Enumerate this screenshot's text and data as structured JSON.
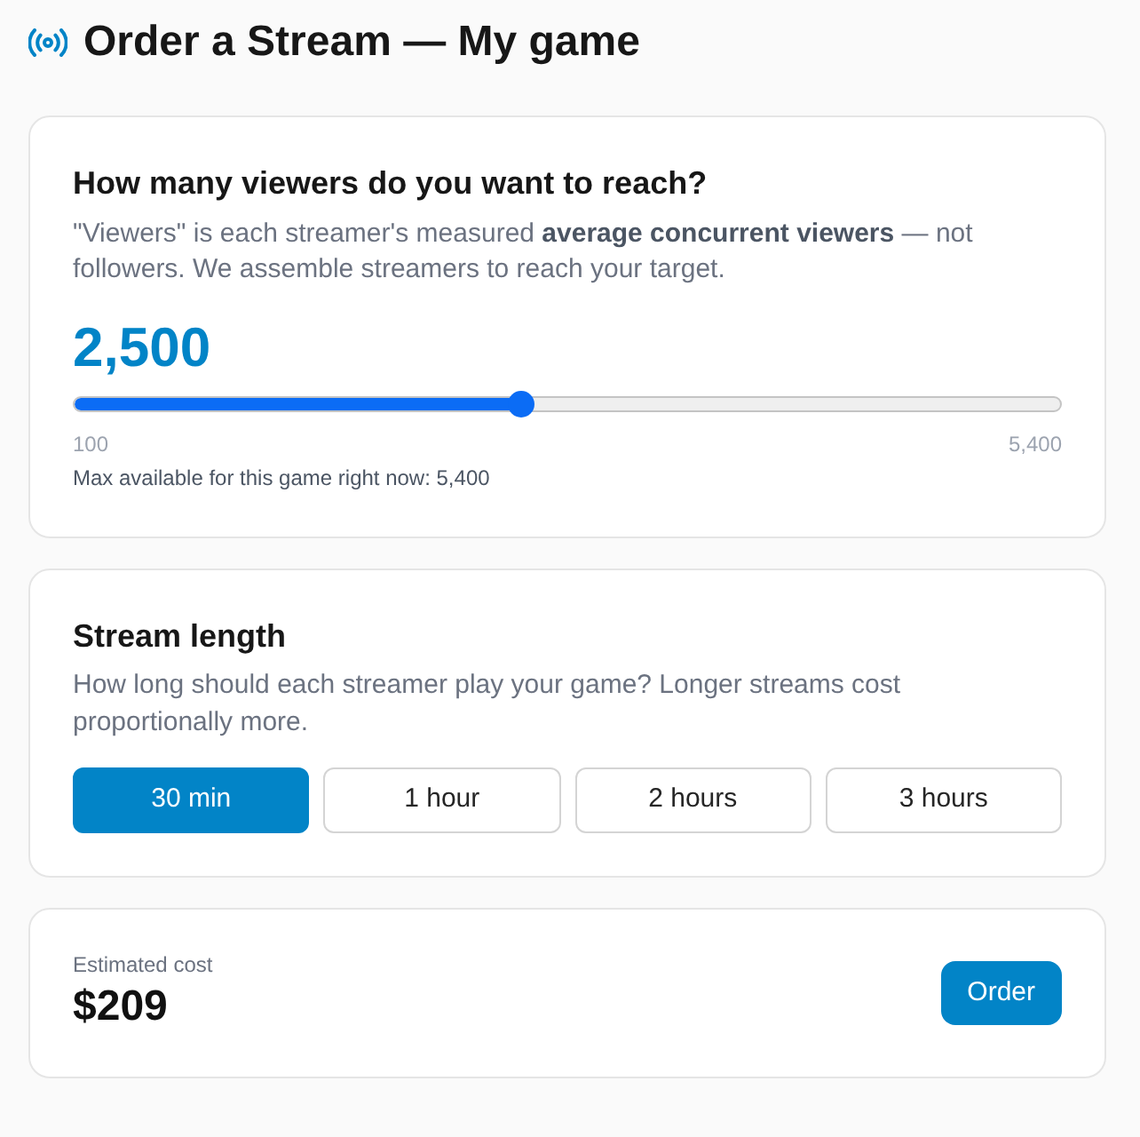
{
  "header": {
    "title": "Order a Stream — My game"
  },
  "viewers": {
    "heading": "How many viewers do you want to reach?",
    "description": "\"Viewers\" is each streamer's measured **average concurrent viewers** — not followers. We assemble streamers to reach your target.",
    "value": "2,500",
    "slider": {
      "level": 0.453,
      "min_label": "100",
      "max_label": "5,400"
    },
    "note": "Max available for this game right now: 5,400"
  },
  "length": {
    "heading": "Stream length",
    "description": "How long should each streamer play your game? Longer streams cost proportionally more.",
    "options": [
      {
        "label": "30 min",
        "selected": true
      },
      {
        "label": "1 hour",
        "selected": false
      },
      {
        "label": "2 hours",
        "selected": false
      },
      {
        "label": "3 hours",
        "selected": false
      }
    ]
  },
  "estimate": {
    "label": "Estimated cost",
    "value": "$209",
    "button": "Order"
  }
}
